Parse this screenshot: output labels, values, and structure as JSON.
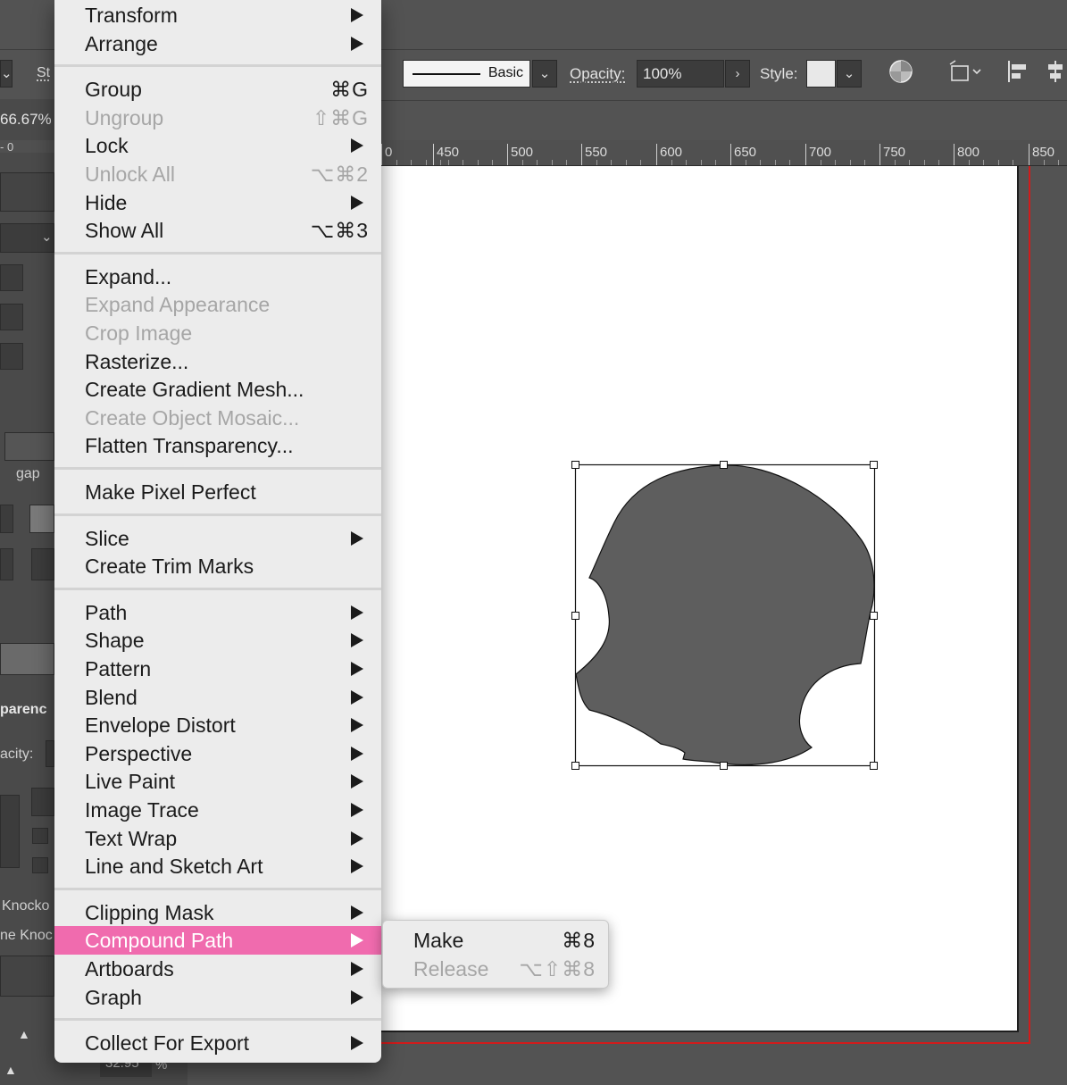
{
  "toolbar": {
    "stroke_profile": "Basic",
    "opacity_label": "Opacity:",
    "opacity_value": "100%",
    "style_label": "Style:",
    "stroke_partial": "St"
  },
  "left_panel": {
    "zoom": "66.67%",
    "gap_label": "gap",
    "transparency_label": "parenc",
    "opacity_label": "acity:",
    "knockout_1": "Knocko",
    "knockout_2": "ne Knoc",
    "bottom_value": "32.95",
    "bottom_unit": "%"
  },
  "ruler": {
    "labels": [
      "0",
      "450",
      "500",
      "550",
      "600",
      "650",
      "700",
      "750",
      "800",
      "850"
    ]
  },
  "menu": {
    "items": [
      {
        "label": "Transform",
        "submenu": true
      },
      {
        "label": "Arrange",
        "submenu": true
      },
      {
        "separator": true
      },
      {
        "label": "Group",
        "shortcut": "⌘G"
      },
      {
        "label": "Ungroup",
        "shortcut": "⇧⌘G",
        "disabled": true
      },
      {
        "label": "Lock",
        "submenu": true
      },
      {
        "label": "Unlock All",
        "shortcut": "⌥⌘2",
        "disabled": true
      },
      {
        "label": "Hide",
        "submenu": true
      },
      {
        "label": "Show All",
        "shortcut": "⌥⌘3"
      },
      {
        "separator": true
      },
      {
        "label": "Expand..."
      },
      {
        "label": "Expand Appearance",
        "disabled": true
      },
      {
        "label": "Crop Image",
        "disabled": true
      },
      {
        "label": "Rasterize..."
      },
      {
        "label": "Create Gradient Mesh..."
      },
      {
        "label": "Create Object Mosaic...",
        "disabled": true
      },
      {
        "label": "Flatten Transparency..."
      },
      {
        "separator": true
      },
      {
        "label": "Make Pixel Perfect"
      },
      {
        "separator": true
      },
      {
        "label": "Slice",
        "submenu": true
      },
      {
        "label": "Create Trim Marks"
      },
      {
        "separator": true
      },
      {
        "label": "Path",
        "submenu": true
      },
      {
        "label": "Shape",
        "submenu": true
      },
      {
        "label": "Pattern",
        "submenu": true
      },
      {
        "label": "Blend",
        "submenu": true
      },
      {
        "label": "Envelope Distort",
        "submenu": true
      },
      {
        "label": "Perspective",
        "submenu": true
      },
      {
        "label": "Live Paint",
        "submenu": true
      },
      {
        "label": "Image Trace",
        "submenu": true
      },
      {
        "label": "Text Wrap",
        "submenu": true
      },
      {
        "label": "Line and Sketch Art",
        "submenu": true
      },
      {
        "separator": true
      },
      {
        "label": "Clipping Mask",
        "submenu": true
      },
      {
        "label": "Compound Path",
        "submenu": true,
        "highlighted": true
      },
      {
        "label": "Artboards",
        "submenu": true
      },
      {
        "label": "Graph",
        "submenu": true
      },
      {
        "separator": true
      },
      {
        "label": "Collect For Export",
        "submenu": true
      }
    ]
  },
  "submenu": {
    "items": [
      {
        "label": "Make",
        "shortcut": "⌘8"
      },
      {
        "label": "Release",
        "shortcut": "⌥⇧⌘8",
        "disabled": true
      }
    ]
  },
  "colors": {
    "highlight": "#f06bae",
    "shape_fill": "#5e5e5e",
    "bleed": "#d21b1b"
  }
}
